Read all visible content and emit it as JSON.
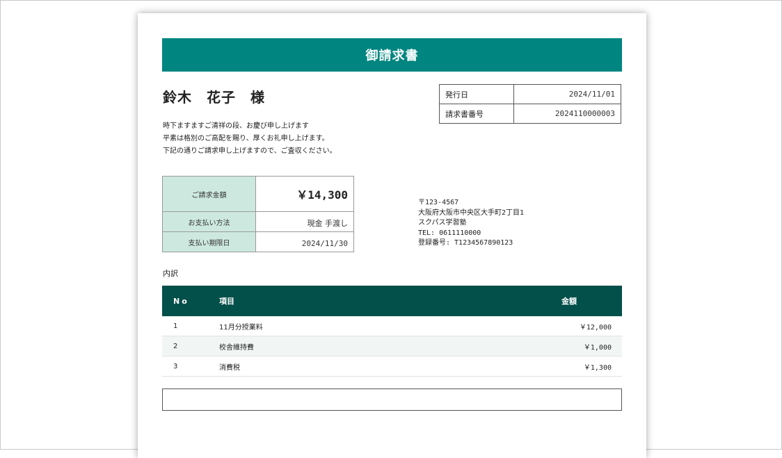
{
  "document": {
    "title": "御請求書",
    "customer_name": "鈴木　花子　様",
    "greeting_lines": [
      "時下ますますご清祥の段、お慶び申し上げます",
      "平素は格別のご高配を賜り、厚くお礼申し上げます。",
      "下記の通りご請求申し上げますので、ご査収ください。"
    ]
  },
  "meta": {
    "issue_date_label": "発行日",
    "issue_date": "2024/11/01",
    "invoice_no_label": "請求書番号",
    "invoice_no": "2024110000003"
  },
  "summary": {
    "amount_label": "ご請求金額",
    "amount": "￥14,300",
    "method_label": "お支払い方法",
    "method": "現金 手渡し",
    "due_label": "支払い期限日",
    "due": "2024/11/30"
  },
  "issuer": {
    "postal": "〒123-4567",
    "address": "大阪府大阪市中央区大手町2丁目1",
    "name": "スクパス学習塾",
    "tel": "TEL: 0611110000",
    "reg": "登録番号: T1234567890123"
  },
  "breakdown": {
    "label": "内訳",
    "headers": {
      "no": "No",
      "item": "項目",
      "amount": "金額"
    },
    "rows": [
      {
        "no": "1",
        "item": "11月分授業料",
        "amount": "￥12,000"
      },
      {
        "no": "2",
        "item": "校舎維持費",
        "amount": "￥1,000"
      },
      {
        "no": "3",
        "item": "消費税",
        "amount": "￥1,300"
      }
    ]
  },
  "colors": {
    "title_bar": "#008580",
    "table_header": "#034f4a",
    "summary_label_bg": "#cde9df"
  }
}
